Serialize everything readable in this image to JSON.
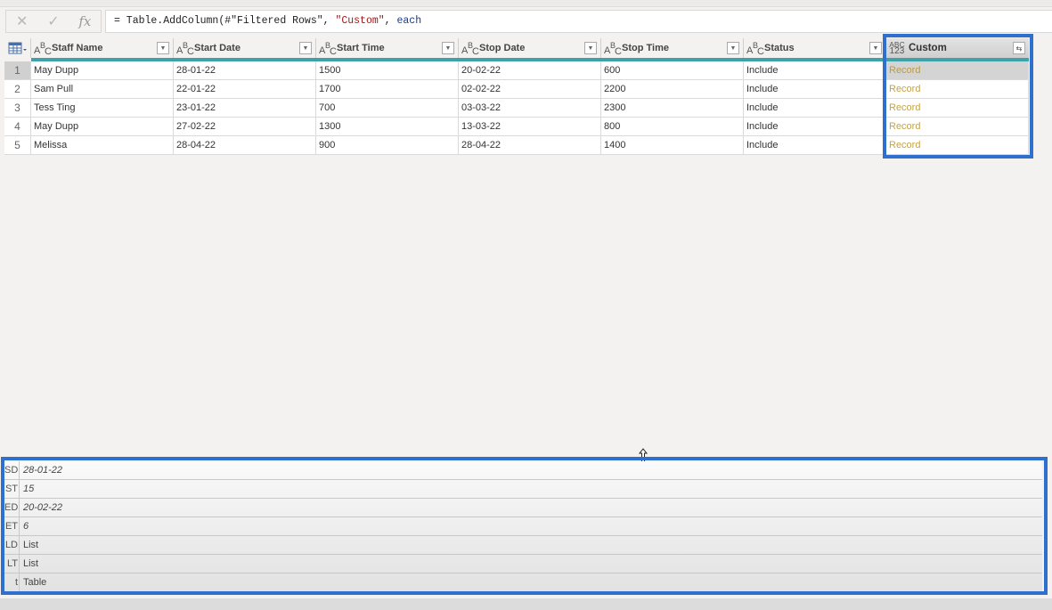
{
  "formula_bar": {
    "cancel_icon": "close-icon",
    "confirm_icon": "check-icon",
    "fx_label": "fx",
    "prefix": "= Table.AddColumn(#\"Filtered Rows\", ",
    "string_arg": "\"Custom\"",
    "sep": ", ",
    "keyword": "each"
  },
  "table": {
    "type_label": "ABC",
    "custom_type_top": "ABC",
    "custom_type_bottom": "123",
    "columns": [
      {
        "label": "Staff Name"
      },
      {
        "label": "Start Date"
      },
      {
        "label": "Start Time"
      },
      {
        "label": "Stop Date"
      },
      {
        "label": "Stop Time"
      },
      {
        "label": "Status"
      },
      {
        "label": "Custom"
      }
    ],
    "rows": [
      {
        "n": "1",
        "cells": [
          "May Dupp",
          "28-01-22",
          "1500",
          "20-02-22",
          "600",
          "Include",
          "Record"
        ]
      },
      {
        "n": "2",
        "cells": [
          "Sam Pull",
          "22-01-22",
          "1700",
          "02-02-22",
          "2200",
          "Include",
          "Record"
        ]
      },
      {
        "n": "3",
        "cells": [
          "Tess Ting",
          "23-01-22",
          "700",
          "03-03-22",
          "2300",
          "Include",
          "Record"
        ]
      },
      {
        "n": "4",
        "cells": [
          "May Dupp",
          "27-02-22",
          "1300",
          "13-03-22",
          "800",
          "Include",
          "Record"
        ]
      },
      {
        "n": "5",
        "cells": [
          "Melissa",
          "28-04-22",
          "900",
          "28-04-22",
          "1400",
          "Include",
          "Record"
        ]
      }
    ]
  },
  "preview": {
    "fields": [
      {
        "key": "SD",
        "value": "28-01-22",
        "italic": true
      },
      {
        "key": "ST",
        "value": "15",
        "italic": true
      },
      {
        "key": "ED",
        "value": "20-02-22",
        "italic": true
      },
      {
        "key": "ET",
        "value": "6",
        "italic": true
      },
      {
        "key": "LD",
        "value": "List",
        "italic": false
      },
      {
        "key": "LT",
        "value": "List",
        "italic": false
      },
      {
        "key": "t",
        "value": "Table",
        "italic": false
      }
    ]
  },
  "colors": {
    "highlight": "#2f6fcd",
    "teal_quality_bar": "#3fa2a8",
    "record_text": "#c4a34a"
  }
}
